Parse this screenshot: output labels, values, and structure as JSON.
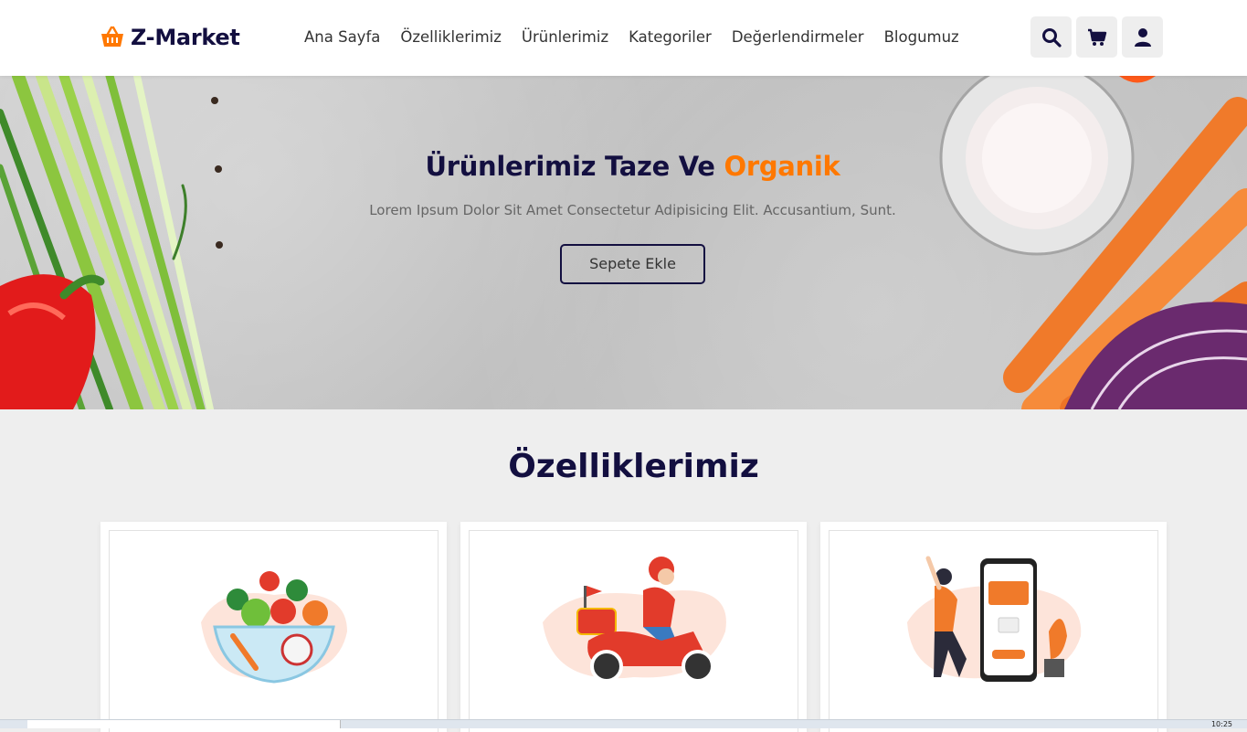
{
  "header": {
    "logo_text": "Z-Market",
    "nav": [
      {
        "label": "Ana Sayfa"
      },
      {
        "label": "Özelliklerimiz"
      },
      {
        "label": "Ürünlerimiz"
      },
      {
        "label": "Kategoriler"
      },
      {
        "label": "Değerlendirmeler"
      },
      {
        "label": "Blogumuz"
      }
    ],
    "icons": [
      "search-icon",
      "cart-icon",
      "user-icon"
    ]
  },
  "hero": {
    "title_main": "Ürünlerimiz Taze Ve",
    "title_accent": "Organik",
    "description": "Lorem Ipsum Dolor Sit Amet Consectetur Adipisicing Elit. Accusantium, Sunt.",
    "button_label": "Sepete Ekle"
  },
  "features": {
    "title": "Özelliklerimiz",
    "cards": [
      {
        "image": "fresh-salad-bowl-illustration"
      },
      {
        "image": "delivery-scooter-illustration"
      },
      {
        "image": "mobile-payment-illustration"
      }
    ]
  },
  "taskbar": {
    "clock": "10:25"
  },
  "colors": {
    "brand_dark": "#130f40",
    "accent": "#ff7800",
    "background": "#eeeeee"
  }
}
